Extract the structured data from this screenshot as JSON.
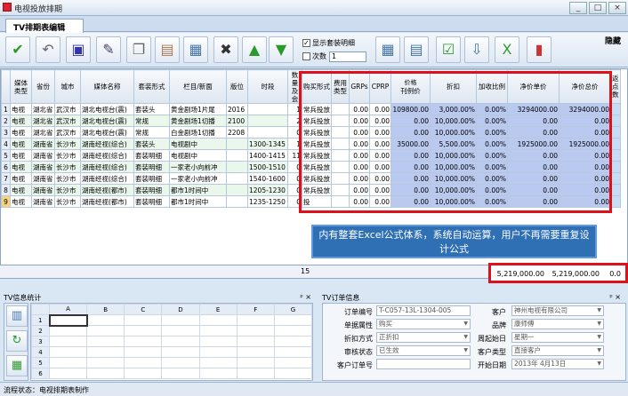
{
  "window": {
    "title": "电视投放排期",
    "buttons": [
      "_",
      "□",
      "×"
    ]
  },
  "tab": {
    "label": "TV排期表编辑",
    "close": "隐藏"
  },
  "toolbar": {
    "icons": [
      "confirm-icon",
      "undo-icon",
      "save-icon",
      "edit-doc-icon",
      "copy-icon",
      "paste-icon",
      "table-icon",
      "delete-icon",
      "move-up-icon",
      "move-down-icon",
      "calendar-icon",
      "grid-icon",
      "check-doc-icon",
      "export-icon",
      "excel-icon",
      "bar-chart-icon"
    ],
    "show_detail": "显示套装明细",
    "times_label": "次数",
    "times_value": "1"
  },
  "grid": {
    "headers": {
      "type": "媒体类型",
      "province": "省份",
      "city": "城市",
      "media": "媒体名称",
      "package": "套装形式",
      "column": "栏目/新面",
      "page": "版位",
      "time": "时段",
      "qty": "数量及会",
      "buy": "购买形式",
      "fee": "费用类型",
      "grps": "GRPs",
      "cprp": "CPRP",
      "price_group": "价格",
      "list": "刊例价",
      "discount": "折扣",
      "markup": "加收比例",
      "net_unit": "净价单价",
      "net_total": "净价总价",
      "extra": "返点数"
    },
    "rows": [
      {
        "n": "1",
        "type": "电视",
        "prov": "湖北省",
        "city": "武汉市",
        "media": "湖北电视台(震)",
        "pkg": "套装头",
        "col": "黄金剧场1片尾",
        "page": "2016",
        "time": "",
        "qty": "1",
        "buy": "常兵投放",
        "grps": "0.00",
        "cprp": "0.00",
        "list": "109800.00",
        "disc": "3,000.00%",
        "mark": "0.00%",
        "unit": "3294000.00",
        "total": "3294000.00"
      },
      {
        "n": "2",
        "type": "电视",
        "prov": "湖北省",
        "city": "武汉市",
        "media": "湖北电视台(震)",
        "pkg": "常规",
        "col": "黄金剧场1切播",
        "page": "2100",
        "time": "",
        "qty": "2",
        "buy": "常兵投放",
        "grps": "0.00",
        "cprp": "0.00",
        "list": "0.00",
        "disc": "10,000.00%",
        "mark": "0.00%",
        "unit": "0.00",
        "total": "0.00"
      },
      {
        "n": "3",
        "type": "电视",
        "prov": "湖北省",
        "city": "武汉市",
        "media": "湖北电视台(震)",
        "pkg": "常规",
        "col": "白金剧场1切播",
        "page": "2208",
        "time": "",
        "qty": "0",
        "buy": "常兵投放",
        "grps": "0.00",
        "cprp": "0.00",
        "list": "0.00",
        "disc": "10,000.00%",
        "mark": "0.00%",
        "unit": "0.00",
        "total": "0.00"
      },
      {
        "n": "4",
        "type": "电视",
        "prov": "湖南省",
        "city": "长沙市",
        "media": "湖南经视(综合)",
        "pkg": "套装头",
        "col": "电视剧中",
        "page": "",
        "time": "1300-1345",
        "qty": "1",
        "buy": "常兵投放",
        "grps": "0.00",
        "cprp": "0.00",
        "list": "35000.00",
        "disc": "5,500.00%",
        "mark": "0.00%",
        "unit": "1925000.00",
        "total": "1925000.00"
      },
      {
        "n": "5",
        "type": "电视",
        "prov": "湖南省",
        "city": "长沙市",
        "media": "湖南经视(综合)",
        "pkg": "套装明细",
        "col": "电视剧中",
        "page": "",
        "time": "1400-1415",
        "qty": "11",
        "buy": "常兵投放",
        "grps": "0.00",
        "cprp": "0.00",
        "list": "0.00",
        "disc": "10,000.00%",
        "mark": "0.00%",
        "unit": "0.00",
        "total": "0.00"
      },
      {
        "n": "6",
        "type": "电视",
        "prov": "湖南省",
        "city": "长沙市",
        "media": "湖南经视(综合)",
        "pkg": "套装明细",
        "col": "一家老小向前冲",
        "page": "",
        "time": "1500-1510",
        "qty": "0",
        "buy": "常兵投放",
        "grps": "0.00",
        "cprp": "0.00",
        "list": "0.00",
        "disc": "10,000.00%",
        "mark": "0.00%",
        "unit": "0.00",
        "total": "0.00"
      },
      {
        "n": "7",
        "type": "电视",
        "prov": "湖南省",
        "city": "长沙市",
        "media": "湖南经视(综合)",
        "pkg": "套装明细",
        "col": "一家老小向前冲",
        "page": "",
        "time": "1540-1600",
        "qty": "0",
        "buy": "常兵投放",
        "grps": "0.00",
        "cprp": "0.00",
        "list": "0.00",
        "disc": "10,000.00%",
        "mark": "0.00%",
        "unit": "0.00",
        "total": "0.00"
      },
      {
        "n": "8",
        "type": "电视",
        "prov": "湖南省",
        "city": "长沙市",
        "media": "湖南经视(都市)",
        "pkg": "套装明细",
        "col": "都市1时间中",
        "page": "",
        "time": "1205-1230",
        "qty": "0",
        "buy": "常兵投放",
        "grps": "0.00",
        "cprp": "0.00",
        "list": "0.00",
        "disc": "10,000.00%",
        "mark": "0.00%",
        "unit": "0.00",
        "total": "0.00"
      },
      {
        "n": "9",
        "type": "电视",
        "prov": "湖南省",
        "city": "长沙市",
        "media": "湖南经视(都市)",
        "pkg": "套装明细",
        "col": "都市1时间中",
        "page": "",
        "time": "1235-1250",
        "qty": "0",
        "buy": "投",
        "grps": "0.00",
        "cprp": "0.00",
        "list": "0.00",
        "disc": "10,000.00%",
        "mark": "0.00%",
        "unit": "0.00",
        "total": "0.00"
      }
    ]
  },
  "callout": "内有整套Excel公式体系，系统自动运算，用户不再需要重复设计公式",
  "totals": {
    "qty": "15",
    "net_unit": "5,219,000.00",
    "net_total": "5,219,000.00",
    "extra": "0.0"
  },
  "left_panel": {
    "title": "TV信息统计",
    "pin": "ᵖ ×",
    "cols": [
      "A",
      "B",
      "C",
      "D",
      "E",
      "F",
      "G"
    ],
    "rows": [
      "1",
      "2",
      "3",
      "4",
      "5",
      "6"
    ]
  },
  "right_panel": {
    "title": "TV订单信息",
    "pin": "ᵖ ×",
    "fields": {
      "order_no_l": "订单编号",
      "order_no": "T-C057-13L-1304-005",
      "customer_l": "客户",
      "customer": "神州电视有限公司",
      "order_attr_l": "单据属性",
      "order_attr": "购买",
      "brand_l": "品牌",
      "brand": "康师傅",
      "discount_l": "折扣方式",
      "discount": "正折扣",
      "week_l": "周起始日",
      "week": "星期一",
      "audit_l": "审核状态",
      "audit": "已生效",
      "ctype_l": "客户类型",
      "ctype": "直接客户",
      "cno_l": "客户订单号",
      "start_l": "开始日期",
      "start": "2013年 4月13日"
    }
  },
  "status": "流程状态：电视排期表制作"
}
